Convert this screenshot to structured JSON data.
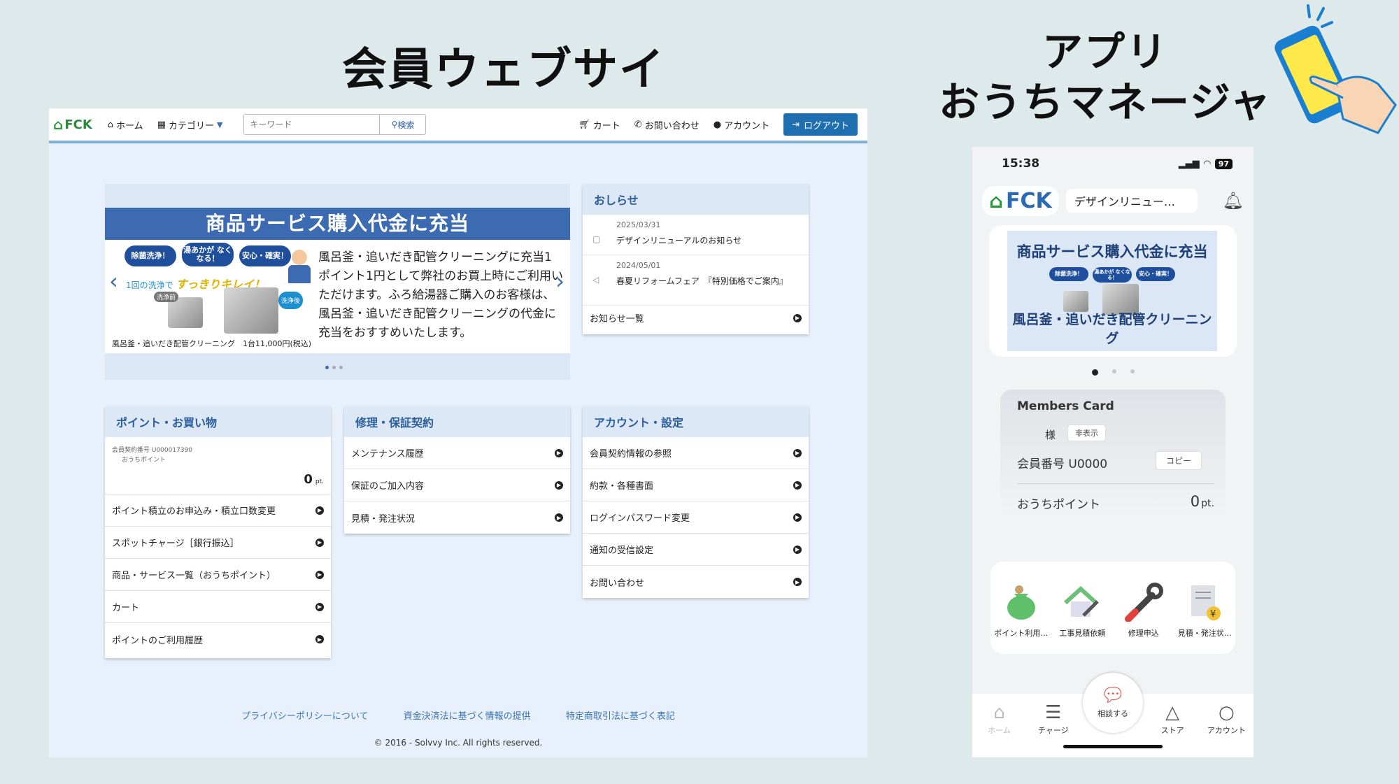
{
  "titles": {
    "web": "会員ウェブサイト",
    "app_line1": "アプリ",
    "app_line2": "おうちマネージャー"
  },
  "web": {
    "nav": {
      "logo": "FCK",
      "home": "ホーム",
      "category": "カテゴリー",
      "search_placeholder": "キーワード",
      "search_button": "検索",
      "cart": "カート",
      "contact": "お問い合わせ",
      "account": "アカウント",
      "logout": "ログアウト"
    },
    "banner": {
      "heading": "商品サービス購入代金に充当",
      "badges": [
        "除菌洗浄！",
        "湯あかが なくなる！",
        "安心・確実！"
      ],
      "script_small": "1回の洗浄で",
      "script_big": "すっきりキレイ！",
      "before": "洗浄前",
      "after": "洗浄後",
      "body": "風呂釜・追いだき配管クリーニングに充当1ポイント1円として弊社のお買上時にご利用いただけます。ふろ給湯器ご購入のお客様は、風呂釜・追いだき配管クリーニングの代金に充当をおすすめいたします。",
      "caption": "風呂釜・追いだき配管クリーニング　1台11,000円(税込)"
    },
    "news": {
      "header": "おしらせ",
      "items": [
        {
          "date": "2025/03/31",
          "title": "デザインリニューアルのお知らせ"
        },
        {
          "date": "2024/05/01",
          "title": "春夏リフォームフェア　『特別価格でご案内』"
        }
      ],
      "all_link": "お知らせ一覧"
    },
    "points_card": {
      "header": "ポイント・お買い物",
      "member_no": "会員契約番号 U000017390",
      "points_label": "おうちポイント",
      "points_value": "0",
      "points_unit": "pt.",
      "items": [
        "ポイント積立のお申込み・積立口数変更",
        "スポットチャージ［銀行振込］",
        "商品・サービス一覧（おうちポイント）",
        "カート",
        "ポイントのご利用履歴"
      ]
    },
    "repair_card": {
      "header": "修理・保証契約",
      "items": [
        "メンテナンス履歴",
        "保証のご加入内容",
        "見積・発注状況"
      ]
    },
    "account_card": {
      "header": "アカウント・設定",
      "items": [
        "会員契約情報の参照",
        "約款・各種書面",
        "ログインパスワード変更",
        "通知の受信設定",
        "お問い合わせ"
      ]
    },
    "footer": {
      "links": [
        "プライバシーポリシーについて",
        "資金決済法に基づく情報の提供",
        "特定商取引法に基づく表記"
      ],
      "copyright": "© 2016 - Solvvy Inc. All rights reserved."
    }
  },
  "app": {
    "status": {
      "time": "15:38",
      "battery": "97"
    },
    "logo": "FCK",
    "notice": "デザインリニュー…",
    "banner": {
      "title": "商品サービス購入代金に充当",
      "subtitle": "風呂釜・追いだき配管クリーニング"
    },
    "members": {
      "title": "Members Card",
      "sama": "様",
      "hide_button": "非表示",
      "member_no": "会員番号 U0000",
      "copy_button": "コピー",
      "points_label": "おうちポイント",
      "points_value": "0",
      "points_unit": "pt."
    },
    "quick_actions": [
      "ポイント利用…",
      "工事見積依頼",
      "修理申込",
      "見積・発注状…"
    ],
    "tabs": {
      "home": "ホーム",
      "charge": "チャージ",
      "consult": "相談する",
      "store": "ストア",
      "account": "アカウント"
    }
  },
  "colors": {
    "primary": "#1f6fb0",
    "brand_green": "#2d9a3c",
    "banner_blue": "#3d6bb2",
    "background": "#dde9ea"
  }
}
